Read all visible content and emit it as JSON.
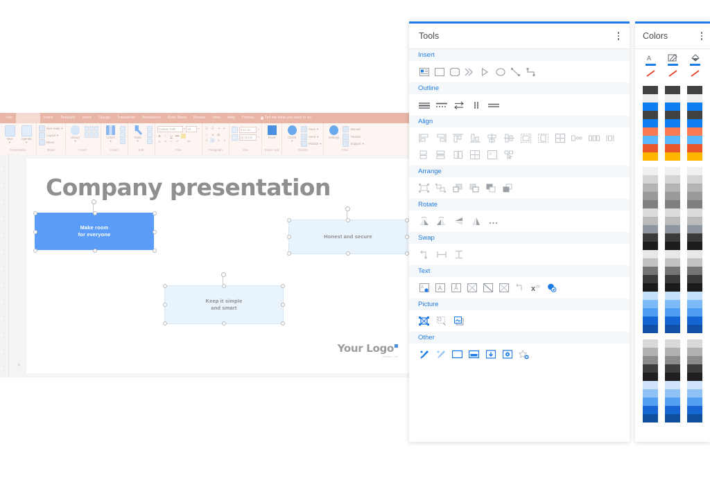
{
  "powerpoint": {
    "tabs": [
      {
        "label": "File",
        "active": false
      },
      {
        "label": "SlideProof",
        "active": true
      },
      {
        "label": "Home",
        "active": false
      },
      {
        "label": "Templafy",
        "active": false
      },
      {
        "label": "Insert",
        "active": false
      },
      {
        "label": "Design",
        "active": false
      },
      {
        "label": "Transitions",
        "active": false
      },
      {
        "label": "Animations",
        "active": false
      },
      {
        "label": "Slide Show",
        "active": false
      },
      {
        "label": "Review",
        "active": false
      },
      {
        "label": "View",
        "active": false
      },
      {
        "label": "Help",
        "active": false
      },
      {
        "label": "Format",
        "active": false
      }
    ],
    "tell_me": "Tell me what you want to do",
    "groups": {
      "presentation": {
        "label": "Presentation",
        "new": "New",
        "agenda": "Agenda"
      },
      "slides": {
        "label": "Slides",
        "new_slide": "New Slide",
        "layout": "Layout",
        "reset": "Reset"
      },
      "insert": {
        "label": "Insert",
        "library": "Library"
      },
      "colors": {
        "label": "Colors",
        "colors_btn": "Colors"
      },
      "edit": {
        "label": "Edit",
        "tools_btn": "Tools"
      },
      "font": {
        "label": "Font",
        "font_name": "Century Goth",
        "font_size": "18",
        "bold": "B",
        "italic": "I",
        "underline": "U",
        "strike": "abc",
        "grow": "A",
        "shrink": "A",
        "subscript": "x₂",
        "superscript": "x²",
        "case": "Aa"
      },
      "paragraph": {
        "label": "Paragraph"
      },
      "size": {
        "label": "Size",
        "height": "3.22 cm",
        "width": "10.10 cm"
      },
      "power_link": {
        "label": "Power Link",
        "excel": "Excel"
      },
      "finalize": {
        "label": "Finalize",
        "check": "Check",
        "save": "Save",
        "send": "Send",
        "publish": "Publish"
      },
      "other": {
        "label": "Other",
        "settings": "Settings",
        "manual": "Manual",
        "tutorial": "Tutorial",
        "support": "Support"
      }
    },
    "slide": {
      "number": "4",
      "title": "Company presentation",
      "shapes": [
        {
          "id": "shape-make-room",
          "line1": "Make room",
          "line2": "for everyone",
          "style": "filled"
        },
        {
          "id": "shape-honest",
          "line1": "Honest and secure",
          "line2": "",
          "style": "light"
        },
        {
          "id": "shape-keep-simple",
          "line1": "Keep it simple",
          "line2": "and smart",
          "style": "light"
        }
      ],
      "logo": {
        "text": "Your Logo",
        "sub": "location · url"
      }
    }
  },
  "tools_panel": {
    "title": "Tools",
    "menu_icon": "kebab-menu-icon",
    "sections": [
      {
        "title": "Insert",
        "icons": [
          "insert-text-box-icon",
          "insert-rectangle-icon",
          "insert-rounded-rectangle-icon",
          "insert-chevrons-icon",
          "insert-triangle-icon",
          "insert-ellipse-icon",
          "insert-line-icon",
          "insert-elbow-connector-icon"
        ]
      },
      {
        "title": "Outline",
        "icons": [
          "outline-solid-icon",
          "outline-dashed-icon",
          "outline-arrows-icon",
          "outline-weight-icon",
          "outline-single-line-icon"
        ]
      },
      {
        "title": "Align",
        "icons": [
          "align-left-icon",
          "align-right-icon",
          "align-top-icon",
          "align-bottom-icon",
          "align-center-horizontal-icon",
          "align-center-vertical-icon",
          "fit-to-slide-icon",
          "fit-height-icon",
          "tile-grid-icon",
          "distribute-horizontal-icon",
          "distribute-spacing-icon",
          "distribute-vertical-icon",
          "same-size-icon",
          "same-height-icon",
          "same-width-icon",
          "size-and-position-icon",
          "fit-text-frame-icon",
          "select-similar-icon"
        ]
      },
      {
        "title": "Arrange",
        "icons": [
          "group-icon",
          "ungroup-icon",
          "bring-forward-icon",
          "bring-to-front-icon",
          "send-backward-icon",
          "send-to-back-icon"
        ]
      },
      {
        "title": "Rotate",
        "icons": [
          "rotate-right-icon",
          "rotate-left-icon",
          "flip-vertical-icon",
          "flip-horizontal-icon",
          "more-rotate-icon"
        ]
      },
      {
        "title": "Swap",
        "icons": [
          "swap-shapes-icon",
          "swap-horizontal-icon",
          "swap-vertical-icon"
        ]
      },
      {
        "title": "Text",
        "icons": [
          "text-fill-icon",
          "text-box-icon",
          "text-autofit-icon",
          "text-margins-icon",
          "text-wrap-icon",
          "text-clear-icon",
          "text-swap-icon",
          "clear-formatting-icon",
          "spellcheck-icon"
        ]
      },
      {
        "title": "Picture",
        "icons": [
          "crop-picture-icon",
          "resize-picture-icon",
          "replace-picture-icon"
        ]
      },
      {
        "title": "Other",
        "icons": [
          "format-painter-icon",
          "pick-format-icon",
          "slide-size-icon",
          "slide-layout-icon",
          "download-icon",
          "settings-gear-icon",
          "remove-favorite-icon"
        ]
      }
    ]
  },
  "colors_panel": {
    "title": "Colors",
    "menu_icon": "kebab-menu-icon",
    "tools": [
      {
        "name": "font-color-tool",
        "glyph": "A"
      },
      {
        "name": "line-color-tool",
        "glyph": "✎"
      },
      {
        "name": "fill-color-tool",
        "glyph": "◢"
      }
    ],
    "no_color": [
      "no-font-color",
      "no-line-color",
      "no-fill-color"
    ],
    "accent": "#1e7ae5",
    "columns": 3,
    "swatches": [
      "#404244",
      "#eeeeee",
      "#0d7ef1",
      "#404244",
      "#0d7ef1",
      "#fa7a51",
      "#5ab8fb",
      "#e8562a",
      "#ffb700",
      "GAP",
      "#f0f0f0",
      "#d4d4d4",
      "#b4b4b4",
      "#9a9a9a",
      "#7e7e7e",
      "#dcdcdc",
      "#bcbcbc",
      "#8e96a0",
      "#3b3b3b",
      "#1d1d1d",
      "#e7e7e7",
      "#c2c2c2",
      "#747474",
      "#3a3a3a",
      "#1a1a1a",
      "#c5e0fb",
      "#7cbaf8",
      "#4f9cf5",
      "#1464d1",
      "#1050a6",
      "GAP",
      "#d9d9d9",
      "#b0b0b0",
      "#8b8b8b",
      "#3d3d3d",
      "#202020",
      "#cfe4fb",
      "#8fc3f7",
      "#53a0f3",
      "#1565d2",
      "#0f4e9c"
    ]
  }
}
